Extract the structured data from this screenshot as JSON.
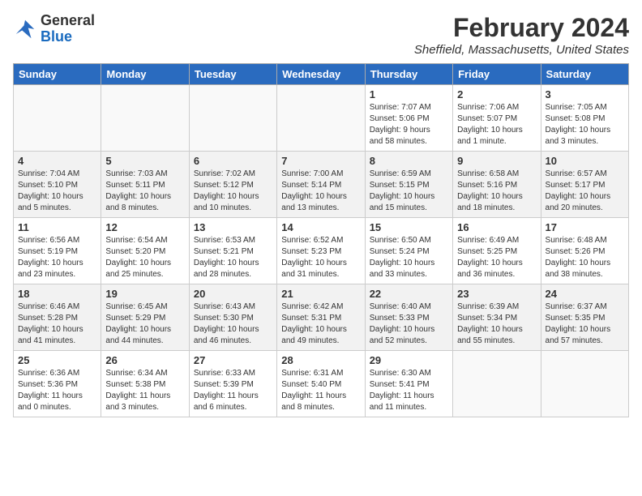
{
  "logo": {
    "line1": "General",
    "line2": "Blue"
  },
  "title": "February 2024",
  "subtitle": "Sheffield, Massachusetts, United States",
  "calendar": {
    "headers": [
      "Sunday",
      "Monday",
      "Tuesday",
      "Wednesday",
      "Thursday",
      "Friday",
      "Saturday"
    ],
    "weeks": [
      [
        {
          "day": "",
          "info": ""
        },
        {
          "day": "",
          "info": ""
        },
        {
          "day": "",
          "info": ""
        },
        {
          "day": "",
          "info": ""
        },
        {
          "day": "1",
          "info": "Sunrise: 7:07 AM\nSunset: 5:06 PM\nDaylight: 9 hours\nand 58 minutes."
        },
        {
          "day": "2",
          "info": "Sunrise: 7:06 AM\nSunset: 5:07 PM\nDaylight: 10 hours\nand 1 minute."
        },
        {
          "day": "3",
          "info": "Sunrise: 7:05 AM\nSunset: 5:08 PM\nDaylight: 10 hours\nand 3 minutes."
        }
      ],
      [
        {
          "day": "4",
          "info": "Sunrise: 7:04 AM\nSunset: 5:10 PM\nDaylight: 10 hours\nand 5 minutes."
        },
        {
          "day": "5",
          "info": "Sunrise: 7:03 AM\nSunset: 5:11 PM\nDaylight: 10 hours\nand 8 minutes."
        },
        {
          "day": "6",
          "info": "Sunrise: 7:02 AM\nSunset: 5:12 PM\nDaylight: 10 hours\nand 10 minutes."
        },
        {
          "day": "7",
          "info": "Sunrise: 7:00 AM\nSunset: 5:14 PM\nDaylight: 10 hours\nand 13 minutes."
        },
        {
          "day": "8",
          "info": "Sunrise: 6:59 AM\nSunset: 5:15 PM\nDaylight: 10 hours\nand 15 minutes."
        },
        {
          "day": "9",
          "info": "Sunrise: 6:58 AM\nSunset: 5:16 PM\nDaylight: 10 hours\nand 18 minutes."
        },
        {
          "day": "10",
          "info": "Sunrise: 6:57 AM\nSunset: 5:17 PM\nDaylight: 10 hours\nand 20 minutes."
        }
      ],
      [
        {
          "day": "11",
          "info": "Sunrise: 6:56 AM\nSunset: 5:19 PM\nDaylight: 10 hours\nand 23 minutes."
        },
        {
          "day": "12",
          "info": "Sunrise: 6:54 AM\nSunset: 5:20 PM\nDaylight: 10 hours\nand 25 minutes."
        },
        {
          "day": "13",
          "info": "Sunrise: 6:53 AM\nSunset: 5:21 PM\nDaylight: 10 hours\nand 28 minutes."
        },
        {
          "day": "14",
          "info": "Sunrise: 6:52 AM\nSunset: 5:23 PM\nDaylight: 10 hours\nand 31 minutes."
        },
        {
          "day": "15",
          "info": "Sunrise: 6:50 AM\nSunset: 5:24 PM\nDaylight: 10 hours\nand 33 minutes."
        },
        {
          "day": "16",
          "info": "Sunrise: 6:49 AM\nSunset: 5:25 PM\nDaylight: 10 hours\nand 36 minutes."
        },
        {
          "day": "17",
          "info": "Sunrise: 6:48 AM\nSunset: 5:26 PM\nDaylight: 10 hours\nand 38 minutes."
        }
      ],
      [
        {
          "day": "18",
          "info": "Sunrise: 6:46 AM\nSunset: 5:28 PM\nDaylight: 10 hours\nand 41 minutes."
        },
        {
          "day": "19",
          "info": "Sunrise: 6:45 AM\nSunset: 5:29 PM\nDaylight: 10 hours\nand 44 minutes."
        },
        {
          "day": "20",
          "info": "Sunrise: 6:43 AM\nSunset: 5:30 PM\nDaylight: 10 hours\nand 46 minutes."
        },
        {
          "day": "21",
          "info": "Sunrise: 6:42 AM\nSunset: 5:31 PM\nDaylight: 10 hours\nand 49 minutes."
        },
        {
          "day": "22",
          "info": "Sunrise: 6:40 AM\nSunset: 5:33 PM\nDaylight: 10 hours\nand 52 minutes."
        },
        {
          "day": "23",
          "info": "Sunrise: 6:39 AM\nSunset: 5:34 PM\nDaylight: 10 hours\nand 55 minutes."
        },
        {
          "day": "24",
          "info": "Sunrise: 6:37 AM\nSunset: 5:35 PM\nDaylight: 10 hours\nand 57 minutes."
        }
      ],
      [
        {
          "day": "25",
          "info": "Sunrise: 6:36 AM\nSunset: 5:36 PM\nDaylight: 11 hours\nand 0 minutes."
        },
        {
          "day": "26",
          "info": "Sunrise: 6:34 AM\nSunset: 5:38 PM\nDaylight: 11 hours\nand 3 minutes."
        },
        {
          "day": "27",
          "info": "Sunrise: 6:33 AM\nSunset: 5:39 PM\nDaylight: 11 hours\nand 6 minutes."
        },
        {
          "day": "28",
          "info": "Sunrise: 6:31 AM\nSunset: 5:40 PM\nDaylight: 11 hours\nand 8 minutes."
        },
        {
          "day": "29",
          "info": "Sunrise: 6:30 AM\nSunset: 5:41 PM\nDaylight: 11 hours\nand 11 minutes."
        },
        {
          "day": "",
          "info": ""
        },
        {
          "day": "",
          "info": ""
        }
      ]
    ]
  }
}
